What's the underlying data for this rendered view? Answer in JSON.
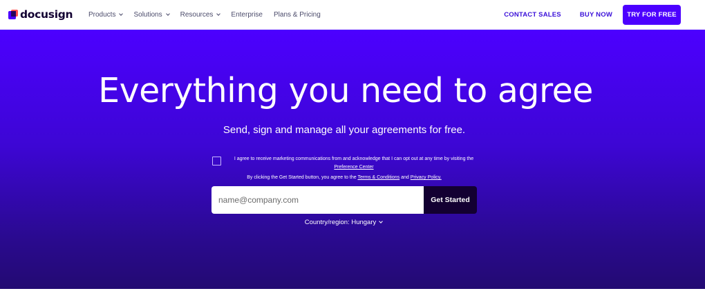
{
  "brand": {
    "name": "docusign"
  },
  "nav": {
    "items": [
      {
        "label": "Products",
        "has_dropdown": true
      },
      {
        "label": "Solutions",
        "has_dropdown": true
      },
      {
        "label": "Resources",
        "has_dropdown": true
      },
      {
        "label": "Enterprise",
        "has_dropdown": false
      },
      {
        "label": "Plans & Pricing",
        "has_dropdown": false
      }
    ],
    "contact_sales": "CONTACT SALES",
    "buy_now": "BUY NOW",
    "try_free": "TRY FOR FREE"
  },
  "hero": {
    "headline": "Everything you need to agree",
    "subheadline": "Send, sign and manage all your agreements for free.",
    "consent": {
      "text_before": "I agree to receive marketing communications from and acknowledge that I can opt out at any time by visiting the ",
      "link": "Preference Center"
    },
    "terms": {
      "text_before": "By clicking the Get Started button, you agree to the ",
      "link1": "Terms & Conditions",
      "middle": " and ",
      "link2": "Privacy Policy."
    },
    "email_placeholder": "name@company.com",
    "submit_label": "Get Started",
    "country": "Country/region: Hungary"
  },
  "colors": {
    "primary": "#4c00ff",
    "dark": "#130032",
    "nav_link": "#3a0fd9",
    "hero_bottom": "#230a72"
  },
  "icons": [
    "docusign-logo-icon",
    "chevron-down-icon",
    "checkbox-icon"
  ]
}
